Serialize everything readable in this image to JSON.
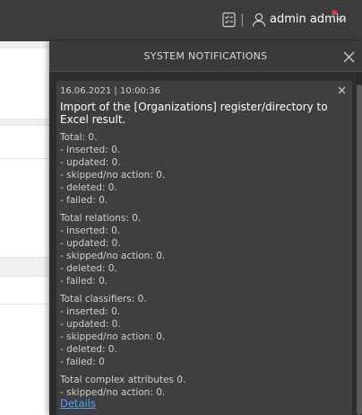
{
  "topbar": {
    "user_name": "admin admin",
    "tasks_icon": "tasks-icon",
    "user_icon": "user-icon",
    "chevron_icon": "chevron-down-icon",
    "notification_dot_color": "#e53935"
  },
  "panel": {
    "title": "SYSTEM NOTIFICATIONS",
    "close_icon": "close-icon"
  },
  "notification": {
    "date": "16.06.2021 | 10:00:36",
    "title": "Import of the [Organizations] register/directory to Excel result.",
    "groups": [
      {
        "lines": [
          "Total: 0.",
          "- inserted: 0.",
          "- updated: 0.",
          "- skipped/no action: 0.",
          "- deleted: 0.",
          "- failed: 0."
        ]
      },
      {
        "lines": [
          "Total relations: 0.",
          "- inserted: 0.",
          "- updated: 0.",
          "- skipped/no action: 0.",
          "- deleted: 0.",
          "- failed: 0."
        ]
      },
      {
        "lines": [
          "Total classifiers: 0.",
          "- inserted: 0.",
          "- updated: 0.",
          "- skipped/no action: 0.",
          "- deleted: 0.",
          "- failed: 0"
        ]
      },
      {
        "lines": [
          "Total complex attributes 0.",
          "- skipped/no action: 0."
        ]
      }
    ],
    "details_link": "Details",
    "link_color": "#4da3ff"
  }
}
